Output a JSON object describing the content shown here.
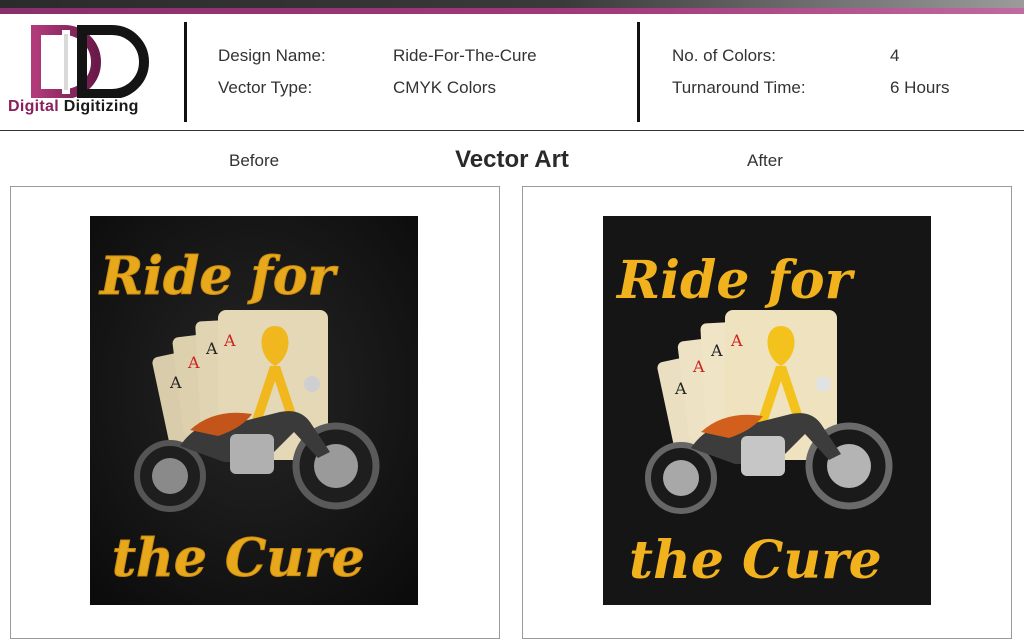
{
  "brand": {
    "word1": "Digital",
    "word2": "Digitizing",
    "colors": {
      "magenta": "#8a1f5a",
      "dark": "#1a1a1a"
    }
  },
  "specs": {
    "design_name_label": "Design Name:",
    "design_name_value": "Ride-For-The-Cure",
    "vector_type_label": "Vector Type:",
    "vector_type_value": "CMYK Colors",
    "colors_label": "No. of Colors:",
    "colors_value": "4",
    "turnaround_label": "Turnaround Time:",
    "turnaround_value": "6 Hours"
  },
  "section_title": "Vector Art",
  "panels": {
    "before_label": "Before",
    "after_label": "After"
  },
  "artwork": {
    "line1": "Ride for",
    "line2": "the Cure",
    "colors": {
      "text": "#f2b21e",
      "background": "#151515",
      "ribbon": "#f4c21c",
      "card": "#efe2bf"
    }
  }
}
